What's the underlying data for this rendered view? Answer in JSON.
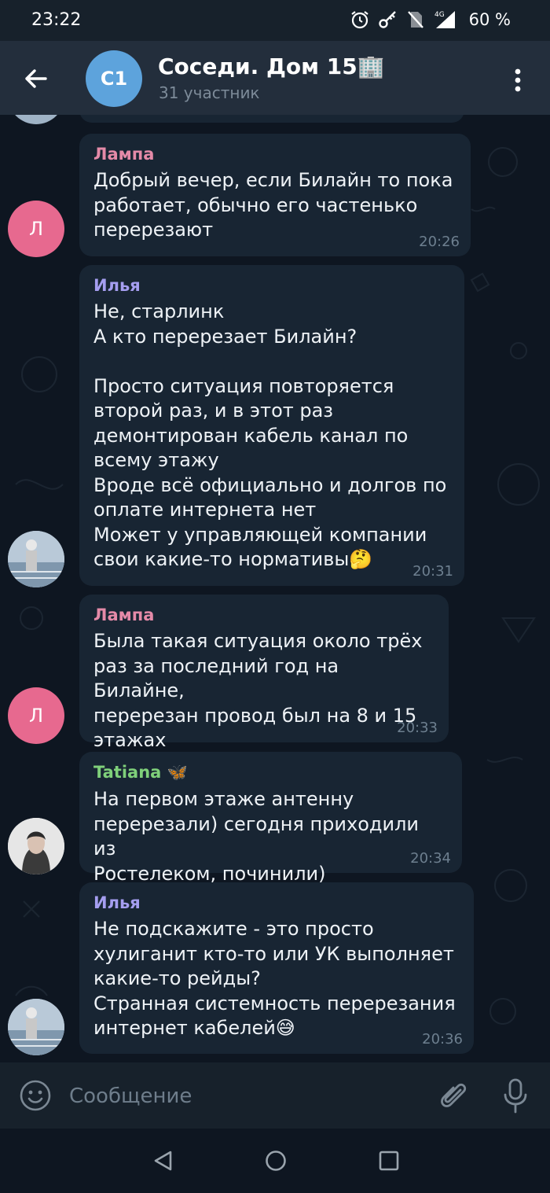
{
  "status_bar": {
    "time": "23:22",
    "battery": "60 %",
    "icons": [
      "alarm-icon",
      "key-icon",
      "no-sim-icon",
      "signal-4g-icon"
    ]
  },
  "header": {
    "avatar_initials": "С1",
    "title": "Соседи. Дом 15🏢",
    "subtitle": "31 участник"
  },
  "colors": {
    "lampa": "#e48aa8",
    "ilya": "#a59ef0",
    "tatiana": "#7fd07a",
    "bubble": "#182533",
    "accent": "#5da3dc"
  },
  "messages": [
    {
      "sender": "Лампа",
      "text": "Добрый вечер, если Билайн то пока\nработает, обычно его частенько\nперерезают",
      "time": "20:26",
      "avatar": "Л"
    },
    {
      "sender": "Илья",
      "text": "Не, старлинк\nА кто перерезает Билайн?\n\nПросто ситуация повторяется\nвторой раз, и в этот раз\nдемонтирован кабель канал по\nвсему этажу\nВроде всё официально и долгов по\nоплате интернета нет\nМожет у управляющей компании\nсвои какие-то нормативы🤔",
      "time": "20:31"
    },
    {
      "sender": "Лампа",
      "text": "Была такая ситуация около трёх\nраз за последний год на Билайне,\nперерезан провод был на 8 и 15\nэтажах",
      "time": "20:33",
      "avatar": "Л"
    },
    {
      "sender": "Tatiana 🦋",
      "text": "На первом этаже антенну\nперерезали) сегодня приходили из\nРостелеком, починили)",
      "time": "20:34"
    },
    {
      "sender": "Илья",
      "text": "Не подскажите - это просто\nхулиганит кто-то или УК выполняет\nкакие-то рейды?\nСтранная системность перерезания\nинтернет кабелей😅",
      "time": "20:36"
    }
  ],
  "input": {
    "placeholder": "Сообщение"
  }
}
